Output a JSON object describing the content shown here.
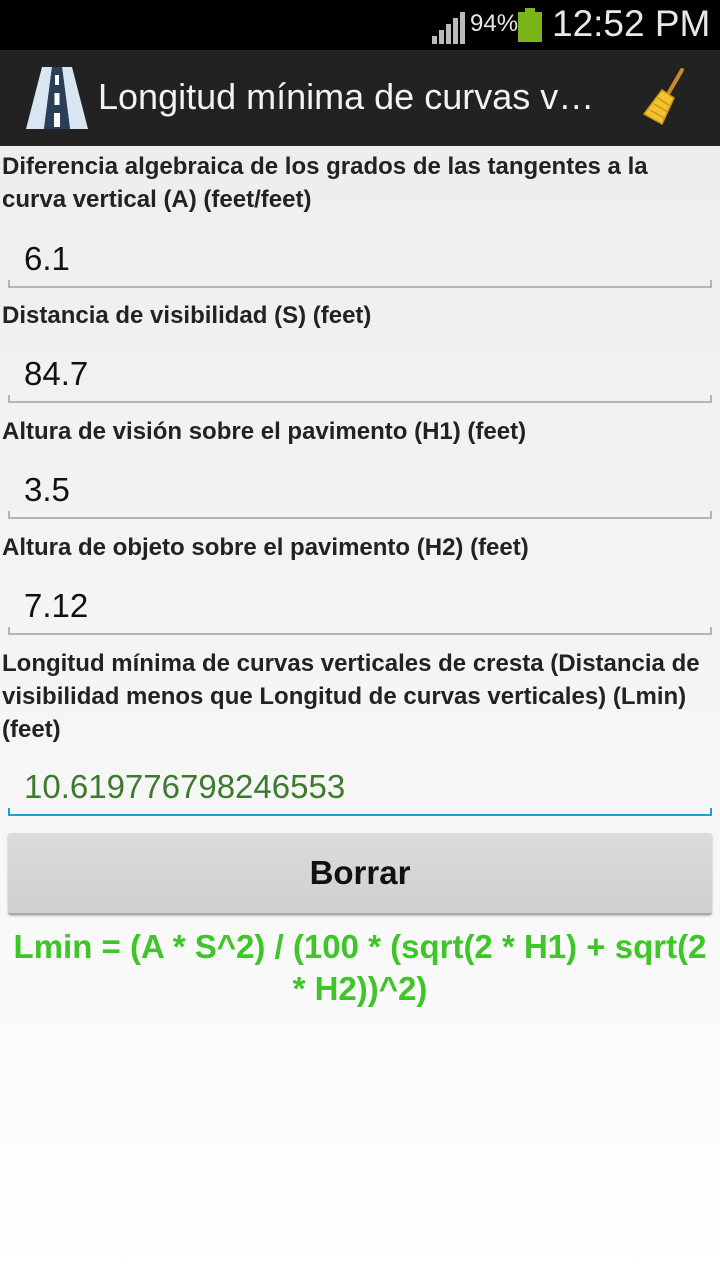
{
  "status_bar": {
    "battery_percent": "94%",
    "time": "12:52 PM",
    "battery_color": "#7ab31a"
  },
  "action_bar": {
    "title": "Longitud mínima de curvas verticales de cresta",
    "app_icon": "road-icon",
    "clear_icon": "broom-icon"
  },
  "fields": [
    {
      "label": "Diferencia algebraica de los grados de las tangentes a la curva vertical (A) (feet/feet)",
      "value": "6.1"
    },
    {
      "label": "Distancia de visibilidad (S) (feet)",
      "value": "84.7"
    },
    {
      "label": "Altura de visión sobre el pavimento (H1) (feet)",
      "value": "3.5"
    },
    {
      "label": "Altura de objeto sobre el pavimento (H2) (feet)",
      "value": "7.12"
    }
  ],
  "result": {
    "label": "Longitud mínima de curvas verticales de cresta (Distancia de visibilidad menos que Longitud de curvas verticales) (Lmin) (feet)",
    "value": "10.619776798246553"
  },
  "clear_button": {
    "label": "Borrar"
  },
  "formula": "Lmin = (A * S^2) / (100 * (sqrt(2 * H1) + sqrt(2 * H2))^2)",
  "colors": {
    "formula": "#3ec528",
    "result_value": "#3e7a2e",
    "active_underline": "#1ea0d4",
    "action_bar": "#222222"
  }
}
